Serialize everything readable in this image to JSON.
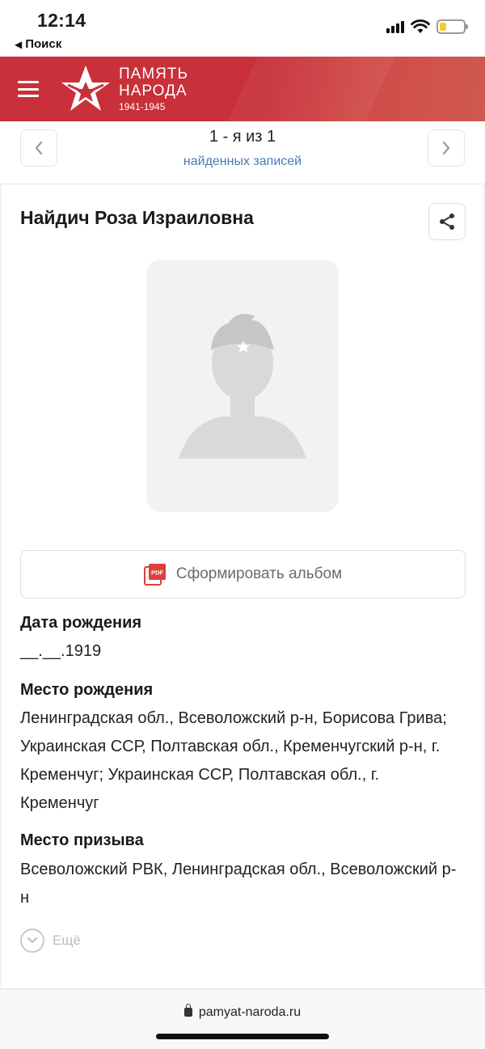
{
  "status_bar": {
    "time": "12:14",
    "back_label": "Поиск"
  },
  "header": {
    "logo_line1": "ПАМЯТЬ",
    "logo_line2": "НАРОДА",
    "logo_years": "1941-1945",
    "brand_color": "#c9303b"
  },
  "pager": {
    "count": "1 - я из 1",
    "subtitle": "найденных записей",
    "prev_icon": "chevron-left-icon",
    "next_icon": "chevron-right-icon"
  },
  "person": {
    "name": "Найдич Роза Израиловна",
    "photo_icon": "soldier-silhouette-icon"
  },
  "album": {
    "label": "Сформировать альбом",
    "icon": "pdf-icon"
  },
  "details": {
    "birth_date_title": "Дата рождения",
    "birth_date_value": "__.__.1919",
    "birth_place_title": "Место рождения",
    "birth_place_value": "Ленинградская обл., Всеволожский р-н, Борисова Грива; Украинская ССР, Полтавская обл., Кременчугский р-н, г. Кременчуг; Украинская ССР, Полтавская обл., г. Кременчуг",
    "draft_place_title": "Место призыва",
    "draft_place_value": "Всеволожский РВК, Ленинградская обл., Всеволожский р-н"
  },
  "more": {
    "label": "Ещё"
  },
  "url_bar": {
    "url": "pamyat-naroda.ru"
  }
}
